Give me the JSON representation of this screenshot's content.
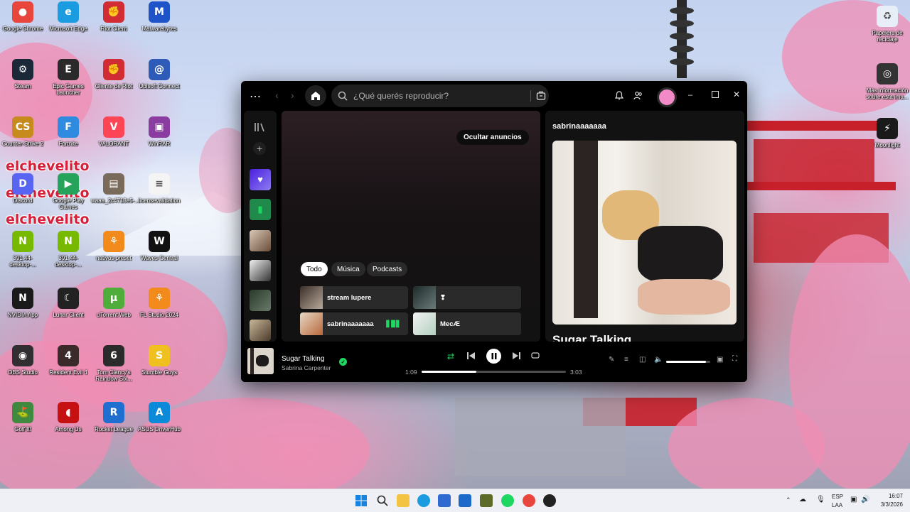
{
  "desktop": {
    "icons": [
      {
        "label": "Google Chrome",
        "icon": "chrome-icon",
        "color": "#e8453c",
        "glyph": "●"
      },
      {
        "label": "Microsoft Edge",
        "icon": "edge-icon",
        "color": "#1b9be0",
        "glyph": "e"
      },
      {
        "label": "Riot Client",
        "icon": "riot-client-icon",
        "color": "#d12c34",
        "glyph": "✊"
      },
      {
        "label": "Malwarebytes",
        "icon": "malwarebytes-icon",
        "color": "#1e54c8",
        "glyph": "M"
      },
      {
        "label": "Steam",
        "icon": "steam-icon",
        "color": "#1b2838",
        "glyph": "⚙"
      },
      {
        "label": "Epic Games Launcher",
        "icon": "epic-games-icon",
        "color": "#2a2a2a",
        "glyph": "E"
      },
      {
        "label": "Cliente de Riot",
        "icon": "riot-client-es-icon",
        "color": "#d12c34",
        "glyph": "✊"
      },
      {
        "label": "Ubisoft Connect",
        "icon": "ubisoft-icon",
        "color": "#2e5ab8",
        "glyph": "@"
      },
      {
        "label": "Counter-Strike 2",
        "icon": "cs2-icon",
        "color": "#c78a1c",
        "glyph": "CS"
      },
      {
        "label": "Fortnite",
        "icon": "fortnite-icon",
        "color": "#2e8be0",
        "glyph": "F"
      },
      {
        "label": "VALORANT",
        "icon": "valorant-icon",
        "color": "#fd4556",
        "glyph": "V"
      },
      {
        "label": "WinRAR",
        "icon": "winrar-icon",
        "color": "#8a3ca0",
        "glyph": "▣"
      },
      {
        "label": "Discord",
        "icon": "discord-icon",
        "color": "#5865f2",
        "glyph": "D"
      },
      {
        "label": "Google Play Games",
        "icon": "google-play-games-icon",
        "color": "#25a35a",
        "glyph": "▶"
      },
      {
        "label": "waaa_2c4718e5-...",
        "icon": "image-file-icon",
        "color": "#7a6a5a",
        "glyph": "▤"
      },
      {
        "label": "licensevalidation",
        "icon": "text-file-icon",
        "color": "#f4f4f4",
        "glyph": "≡"
      },
      {
        "label": "391.44-desktop-...",
        "icon": "nvidia-installer-icon",
        "color": "#76b900",
        "glyph": "N"
      },
      {
        "label": "391.44-desktop-...",
        "icon": "nvidia-installer-2-icon",
        "color": "#76b900",
        "glyph": "N"
      },
      {
        "label": "nativos preset",
        "icon": "fl-preset-icon",
        "color": "#f28a1c",
        "glyph": "⚘"
      },
      {
        "label": "Waves Central",
        "icon": "waves-icon",
        "color": "#111111",
        "glyph": "W"
      },
      {
        "label": "NVIDIA App",
        "icon": "nvidia-app-icon",
        "color": "#1a1a1a",
        "glyph": "N"
      },
      {
        "label": "Lunar Client",
        "icon": "lunar-client-icon",
        "color": "#222222",
        "glyph": "☾"
      },
      {
        "label": "uTorrent Web",
        "icon": "utorrent-icon",
        "color": "#4fae3a",
        "glyph": "µ"
      },
      {
        "label": "FL Studio 2024",
        "icon": "fl-studio-icon",
        "color": "#f28a1c",
        "glyph": "⚘"
      },
      {
        "label": "OBS Studio",
        "icon": "obs-icon",
        "color": "#302e31",
        "glyph": "◉"
      },
      {
        "label": "Resident Evil 4",
        "icon": "resident-evil-icon",
        "color": "#3a2a2a",
        "glyph": "4"
      },
      {
        "label": "Tom Clancy's Rainbow Six...",
        "icon": "rainbow-six-icon",
        "color": "#2b2b2b",
        "glyph": "6"
      },
      {
        "label": "Stumble Guys",
        "icon": "stumble-guys-icon",
        "color": "#f0c020",
        "glyph": "S"
      },
      {
        "label": "Golf It!",
        "icon": "golf-it-icon",
        "color": "#3f8a3f",
        "glyph": "⛳"
      },
      {
        "label": "Among Us",
        "icon": "among-us-icon",
        "color": "#c51111",
        "glyph": "◖"
      },
      {
        "label": "Rocket League",
        "icon": "rocket-league-icon",
        "color": "#1f6fd1",
        "glyph": "R"
      },
      {
        "label": "ASUS DriverHub",
        "icon": "asus-driverhub-icon",
        "color": "#0a8ad8",
        "glyph": "A"
      },
      {
        "label": "Papelera de reciclaje",
        "icon": "recycle-bin-icon",
        "color": "#e7eef8",
        "glyph": "♻"
      },
      {
        "label": "Más información sobre esta ima...",
        "icon": "image-info-icon",
        "color": "#333333",
        "glyph": "◎"
      },
      {
        "label": "Moonlight",
        "icon": "moonlight-icon",
        "color": "#1a1a1a",
        "glyph": "⚡"
      }
    ],
    "overlay_text": "elchevelito"
  },
  "spotify": {
    "search": {
      "placeholder": "¿Qué querés reproducir?"
    },
    "hide_ads": "Ocultar anuncios",
    "filters": [
      "Todo",
      "Música",
      "Podcasts"
    ],
    "cards": [
      {
        "title": "stream lupere"
      },
      {
        "title": "❣"
      },
      {
        "title": "sabrinaaaaaaa"
      },
      {
        "title": "MecÆ"
      }
    ],
    "right_panel": {
      "title": "sabrinaaaaaaa",
      "track": "Sugar Talking"
    },
    "player": {
      "track": "Sugar Talking",
      "artist": "Sabrina Carpenter",
      "elapsed": "1:09",
      "duration": "3:03",
      "progress": 0.38,
      "volume": 0.9
    },
    "colors": {
      "accent": "#1ed760",
      "background": "#000000",
      "panel": "#121212"
    }
  },
  "taskbar": {
    "tray": {
      "lang": "ESP",
      "layout": "LAA",
      "time": "16:07",
      "date": "3/3/2026"
    }
  }
}
